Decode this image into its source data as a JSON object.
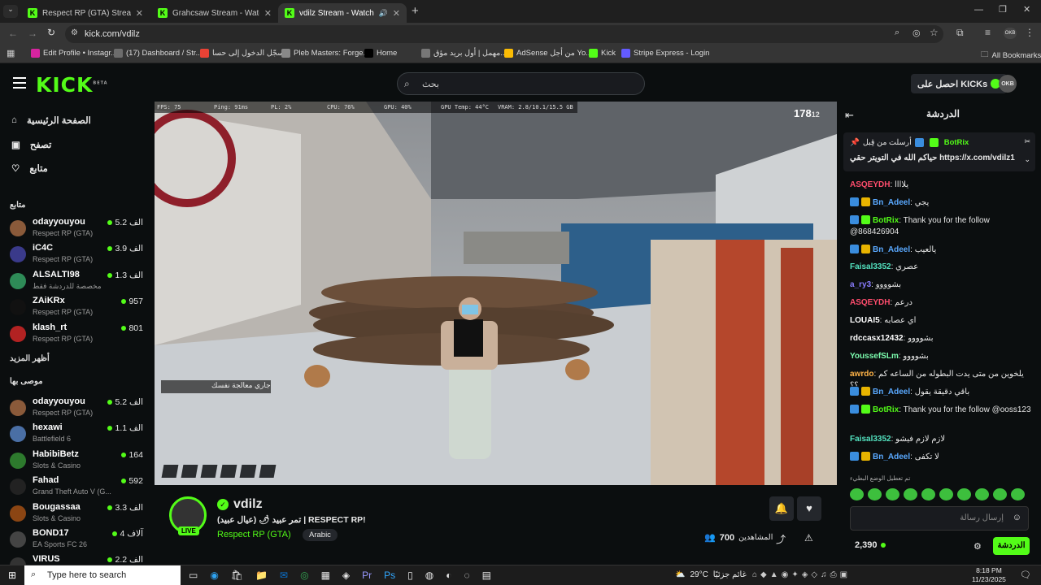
{
  "browser": {
    "tabs": [
      {
        "title": "Respect RP (GTA) Streaming - Li"
      },
      {
        "title": "Grahcsaw Stream - Watch Live o"
      },
      {
        "title": "vdilz Stream - Watch Live on"
      }
    ],
    "new_tab": "+",
    "url": "kick.com/vdilz",
    "bookmarks": [
      {
        "label": "Edit Profile • Instagr...",
        "color": "#d6249f"
      },
      {
        "label": "(17) Dashboard / Str...",
        "color": "#6c6c6c"
      },
      {
        "label": "سجّل الدخول إلى حسا...",
        "color": "#e94235"
      },
      {
        "label": "Pleb Masters: Forge...",
        "color": "#888"
      },
      {
        "label": "Home",
        "color": "#000"
      },
      {
        "label": "مهمل | أول بريد مؤق...",
        "color": "#777"
      },
      {
        "label": "AdSense من أجل Yo...",
        "color": "#fbbc04"
      },
      {
        "label": "Kick",
        "color": "#53fc18"
      },
      {
        "label": "Stripe Express - Login",
        "color": "#635bff"
      }
    ],
    "all_bookmarks": "All Bookmarks"
  },
  "header": {
    "logo": "KICK",
    "beta": "BETA",
    "search_placeholder": "بحث",
    "get_kicks": "احصل على KICKs",
    "avatar": "OKB"
  },
  "nav": [
    {
      "label": "الصفحة الرئيسية",
      "icon": "home-icon"
    },
    {
      "label": "تصفح",
      "icon": "browse-icon"
    },
    {
      "label": "متابع",
      "icon": "heart-icon"
    }
  ],
  "following_header": "متابع",
  "following": [
    {
      "name": "odayyouyou",
      "category": "Respect RP (GTA)",
      "viewers": "5.2 الف",
      "color": "#8a5a3a"
    },
    {
      "name": "iC4C",
      "category": "Respect RP (GTA)",
      "viewers": "3.9 الف",
      "color": "#3a3a8a"
    },
    {
      "name": "ALSALTI98",
      "category": "مخصصة للدردشة فقط",
      "viewers": "1.3 الف",
      "color": "#2e8b57"
    },
    {
      "name": "ZAiKRx",
      "category": "Respect RP (GTA)",
      "viewers": "957",
      "color": "#111"
    },
    {
      "name": "klash_rt",
      "category": "Respect RP (GTA)",
      "viewers": "801",
      "color": "#b22222"
    }
  ],
  "show_more": "أظهر المزيد",
  "recommended_header": "موصى بها",
  "recommended": [
    {
      "name": "odayyouyou",
      "category": "Respect RP (GTA)",
      "viewers": "5.2 الف",
      "color": "#8a5a3a"
    },
    {
      "name": "hexawi",
      "category": "Battlefield 6",
      "viewers": "1.1 الف",
      "color": "#4a6fa5"
    },
    {
      "name": "HabibiBetz",
      "category": "Slots & Casino",
      "viewers": "164",
      "color": "#2d7a2d"
    },
    {
      "name": "Fahad",
      "category": "Grand Theft Auto V (G...",
      "viewers": "592",
      "color": "#222"
    },
    {
      "name": "Bougassaa",
      "category": "Slots & Casino",
      "viewers": "3.3 الف",
      "color": "#8b4513"
    },
    {
      "name": "BOND17",
      "category": "EA Sports FC 26",
      "viewers": "4 آلاف",
      "color": "#444"
    },
    {
      "name": "VIRUS",
      "category": "",
      "viewers": "2.2 الف",
      "color": "#333"
    }
  ],
  "video": {
    "stats": {
      "fps": "FPS: 75",
      "ping": "Ping: 91ms",
      "pl": "PL: 2%",
      "cpu": "CPU: 76%",
      "gpu": "GPU: 40%",
      "gputemp": "GPU Temp: 44°C",
      "vram": "VRAM: 2.8/10.1/15.5 GB"
    },
    "ammo": "178",
    "ammo_small": "12",
    "toast": "جاري معالجة نفسك"
  },
  "stream": {
    "streamer": "vdilz",
    "live": "LIVE",
    "title": "تمر عبيد 🌶 (عيال عبيد) | RESPECT RP!",
    "category": "Respect RP (GTA)",
    "language": "Arabic",
    "viewers": "700",
    "viewers_label": "المشاهدين"
  },
  "chat": {
    "title": "الدردشة",
    "pinned_by": "أرسلت من قِبل",
    "pinned_user": "BotRix",
    "pinned_text": "حياكم الله في التويتر حقي https://x.com/vdilz1",
    "messages": [
      {
        "user": "ASQEYDH",
        "color": "#ff4d6d",
        "badges": [],
        "text": "يلاااا"
      },
      {
        "user": "Bn_Adeel",
        "color": "#5aa9ff",
        "badges": [
          "#3a8dde",
          "#e8b400"
        ],
        "text": "يجي"
      },
      {
        "user": "BotRix",
        "color": "#53fc18",
        "badges": [
          "#3a8dde",
          "#53fc18"
        ],
        "text": "Thank you for the follow @868426904"
      },
      {
        "user": "Bn_Adeel",
        "color": "#5aa9ff",
        "badges": [
          "#3a8dde",
          "#e8b400"
        ],
        "text": "يالعيب"
      },
      {
        "user": "Faisal3352",
        "color": "#53e3c0",
        "badges": [],
        "text": "عصري"
      },
      {
        "user": "a_ry3",
        "color": "#8a7dff",
        "badges": [],
        "text": "بشوووو"
      },
      {
        "user": "ASQEYDH",
        "color": "#ff4d6d",
        "badges": [],
        "text": "درعم"
      },
      {
        "user": "LOUAI5",
        "color": "#fff",
        "badges": [],
        "text": "اي عصابه"
      },
      {
        "user": "rdccasx12432",
        "color": "#fff",
        "badges": [],
        "text": "بشوووو"
      },
      {
        "user": "YoussefSLm",
        "color": "#7dffb0",
        "badges": [],
        "text": "بشوووو"
      },
      {
        "user": "awrdo",
        "color": "#ffb347",
        "badges": [],
        "text": "يلخوين من متى يدت البطوله من الساعه كم ؟؟"
      },
      {
        "user": "Bn_Adeel",
        "color": "#5aa9ff",
        "badges": [
          "#3a8dde",
          "#e8b400"
        ],
        "text": "باقي دقيقة يقول"
      },
      {
        "user": "BotRix",
        "color": "#53fc18",
        "badges": [
          "#3a8dde",
          "#53fc18"
        ],
        "text": "Thank you for the follow @ooss123"
      },
      {
        "user": "Faisal3352",
        "color": "#53e3c0",
        "badges": [],
        "text": "لازم لازم فيشو"
      },
      {
        "user": "Bn_Adeel",
        "color": "#5aa9ff",
        "badges": [
          "#3a8dde",
          "#e8b400"
        ],
        "text": "لا تكفى"
      }
    ],
    "mode_note": "تم تعطيل الوضع البطيء",
    "input_placeholder": "إرسال رسالة",
    "points": "2,390",
    "send": "الدردشة"
  },
  "taskbar": {
    "search": "Type here to search",
    "weather": "29°C",
    "weather_label": "غائم جزئيًا",
    "time": "8:18 PM",
    "date": "11/23/2025"
  }
}
